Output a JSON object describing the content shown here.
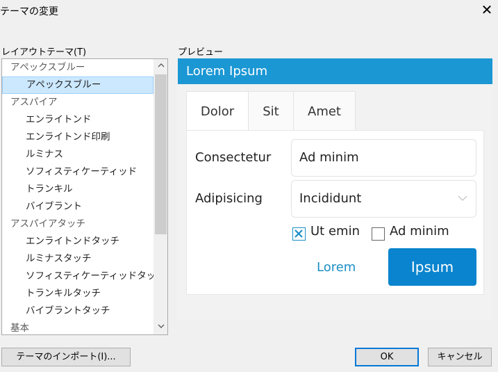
{
  "window": {
    "title": "テーマの変更",
    "close_glyph": "✕"
  },
  "layout_theme_label": "レイアウトテーマ(T)",
  "preview_label": "プレビュー",
  "theme_list": {
    "items": [
      {
        "label": "アペックスブルー",
        "kind": "group",
        "selected": false
      },
      {
        "label": "アペックスブルー",
        "kind": "child",
        "selected": true
      },
      {
        "label": "アスパイア",
        "kind": "group",
        "selected": false
      },
      {
        "label": "エンライトンド",
        "kind": "child",
        "selected": false
      },
      {
        "label": "エンライトンド印刷",
        "kind": "child",
        "selected": false
      },
      {
        "label": "ルミナス",
        "kind": "child",
        "selected": false
      },
      {
        "label": "ソフィスティケーティッド",
        "kind": "child",
        "selected": false
      },
      {
        "label": "トランキル",
        "kind": "child",
        "selected": false
      },
      {
        "label": "バイブラント",
        "kind": "child",
        "selected": false
      },
      {
        "label": "アスパイアタッチ",
        "kind": "group",
        "selected": false
      },
      {
        "label": "エンライトンドタッチ",
        "kind": "child",
        "selected": false
      },
      {
        "label": "ルミナスタッチ",
        "kind": "child",
        "selected": false
      },
      {
        "label": "ソフィスティケーティッドタッチ",
        "kind": "child",
        "selected": false
      },
      {
        "label": "トランキルタッチ",
        "kind": "child",
        "selected": false
      },
      {
        "label": "バイブラントタッチ",
        "kind": "child",
        "selected": false
      },
      {
        "label": "基本",
        "kind": "group",
        "selected": false
      }
    ],
    "scroll_up_icon": "chevron-up-icon",
    "scroll_down_icon": "chevron-down-icon"
  },
  "preview": {
    "header": "Lorem Ipsum",
    "tabs": [
      {
        "label": "Dolor",
        "active": true
      },
      {
        "label": "Sit",
        "active": false
      },
      {
        "label": "Amet",
        "active": false
      }
    ],
    "field1": {
      "label": "Consectetur",
      "value": "Ad minim"
    },
    "field2": {
      "label": "Adipisicing",
      "value": "Incididunt"
    },
    "check1": {
      "label": "Ut emin",
      "checked": true
    },
    "check2": {
      "label": "Ad minim",
      "checked": false
    },
    "link": "Lorem",
    "button": "Ipsum"
  },
  "buttons": {
    "import": "テーマのインポート(I)...",
    "ok": "OK",
    "cancel": "キャンセル"
  },
  "colors": {
    "preview_accent": "#1b97d4",
    "preview_button": "#0a84ce",
    "selection": "#cce8ff"
  }
}
